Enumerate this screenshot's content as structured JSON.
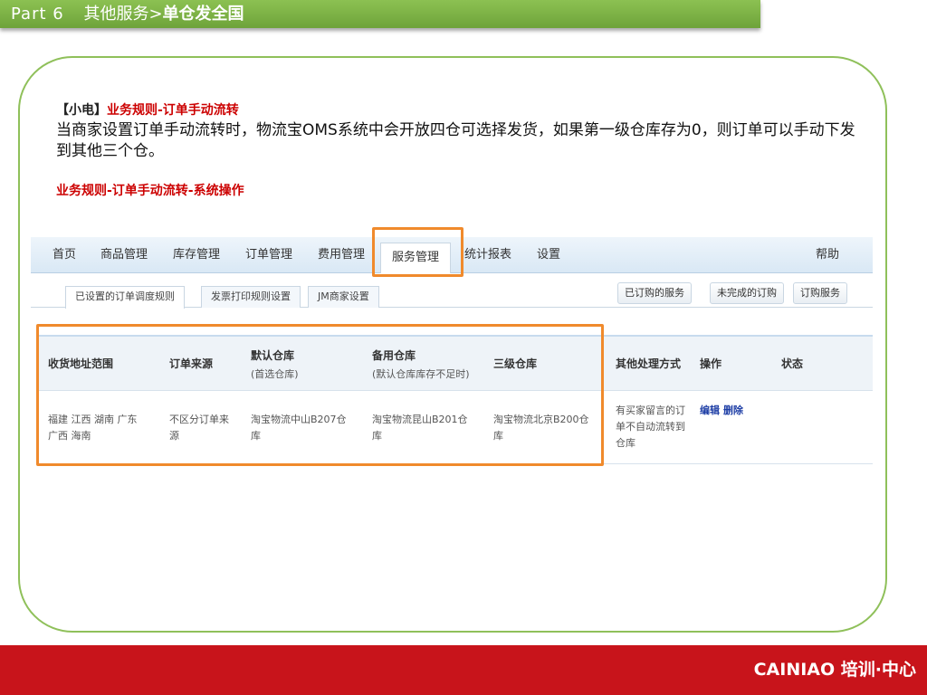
{
  "header": {
    "part": "Part  6",
    "section": "其他服务>",
    "title": "单仓发全国"
  },
  "intro": {
    "bracket_label": "【小电】",
    "rule_title": "业务规则-订单手动流转",
    "body": "当商家设置订单手动流转时，物流宝OMS系统中会开放四仓可选择发货，如果第一级仓库存为0，则订单可以手动下发到其他三个仓。"
  },
  "subheading": "业务规则-订单手动流转-系统操作",
  "nav": {
    "items": [
      "首页",
      "商品管理",
      "库存管理",
      "订单管理",
      "费用管理",
      "服务管理",
      "统计报表",
      "设置"
    ],
    "help": "帮助"
  },
  "tabs": {
    "items": [
      "已设置的订单调度规则",
      "发票打印规则设置",
      "JM商家设置"
    ],
    "right_buttons": [
      "已订购的服务",
      "未完成的订购",
      "订购服务"
    ]
  },
  "table": {
    "headers": [
      {
        "title": "收货地址范围",
        "sub": ""
      },
      {
        "title": "订单来源",
        "sub": ""
      },
      {
        "title": "默认仓库",
        "sub": "(首选仓库)"
      },
      {
        "title": "备用仓库",
        "sub": "(默认仓库库存不足时)"
      },
      {
        "title": "三级仓库",
        "sub": ""
      },
      {
        "title": "其他处理方式",
        "sub": ""
      },
      {
        "title": "操作",
        "sub": ""
      },
      {
        "title": "状态",
        "sub": ""
      }
    ],
    "row": {
      "region": "福建 江西 湖南 广东 广西 海南",
      "source": "不区分订单来源",
      "default_wh": "淘宝物流中山B207仓库",
      "backup_wh": "淘宝物流昆山B201仓库",
      "third_wh": "淘宝物流北京B200仓库",
      "other": "有买家留言的订单不自动流转到仓库",
      "edit": "编辑",
      "delete": "删除",
      "status": ""
    }
  },
  "footer": {
    "brand": "CAINIAO  培训·中心"
  },
  "colors": {
    "header_green": "#7ab443",
    "frame_green": "#8fc05a",
    "highlight_orange": "#f08a2c",
    "accent_red": "#cc0000",
    "footer_red": "#c8141b",
    "link_blue": "#1f3fa6"
  }
}
